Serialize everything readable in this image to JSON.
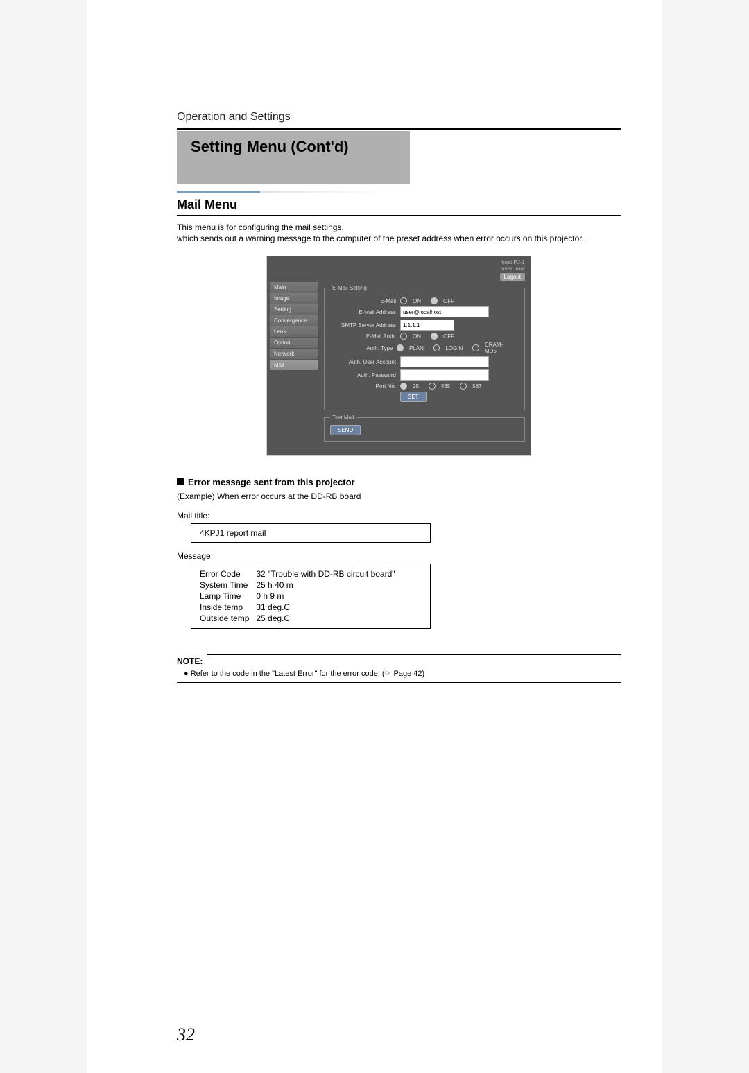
{
  "breadcrumb": "Operation and Settings",
  "title": "Setting Menu (Cont'd)",
  "section_title": "Mail Menu",
  "intro_line1": "This menu is for configuring the mail settings,",
  "intro_line2": "which sends out a warning message to the computer of the preset address when error occurs on this projector.",
  "webui": {
    "host": "host:PJ-1",
    "user": "user: root",
    "logout": "Logout",
    "nav": [
      "Main",
      "Image",
      "Setting",
      "Convergence",
      "Lens",
      "Option",
      "Network",
      "Mail"
    ],
    "nav_active": "Mail",
    "fieldset1": "E-Mail Setting",
    "rows": {
      "email_label": "E-Mail",
      "on": "ON",
      "off": "OFF",
      "email_addr_label": "E-Mail Address",
      "email_addr_value": "user@localhost",
      "smtp_label": "SMTP Server Address",
      "smtp_value": "1.1.1.1",
      "auth_label": "E-Mail Auth.",
      "auth_type_label": "Auth. Type",
      "auth_type_opts": [
        "PLAN",
        "LOGIN",
        "CRAM-MD5"
      ],
      "auth_user_label": "Auth. User Account",
      "auth_pass_label": "Auth. Password",
      "port_label": "Port No.",
      "port_opts": [
        "25",
        "465",
        "587"
      ],
      "set_btn": "SET"
    },
    "fieldset2": "Tset Mail",
    "send_btn": "SEND"
  },
  "error_section_title": "Error message sent from this projector",
  "example_line": "(Example) When error occurs at the DD-RB board",
  "mail_title_label": "Mail title:",
  "mail_title_value": "4KPJ1 report mail",
  "message_label": "Message:",
  "message_table": [
    [
      "Error Code",
      "32 \"Trouble with DD-RB circuit board\""
    ],
    [
      "System Time",
      "25 h 40 m"
    ],
    [
      "Lamp Time",
      "0 h 9 m"
    ],
    [
      "Inside temp",
      "31 deg.C"
    ],
    [
      "Outside temp",
      "25 deg.C"
    ]
  ],
  "note_label": "NOTE:",
  "note_text": "● Refer to the code in the \"Latest Error\" for the error code. (☞ Page 42)",
  "page_number": "32"
}
